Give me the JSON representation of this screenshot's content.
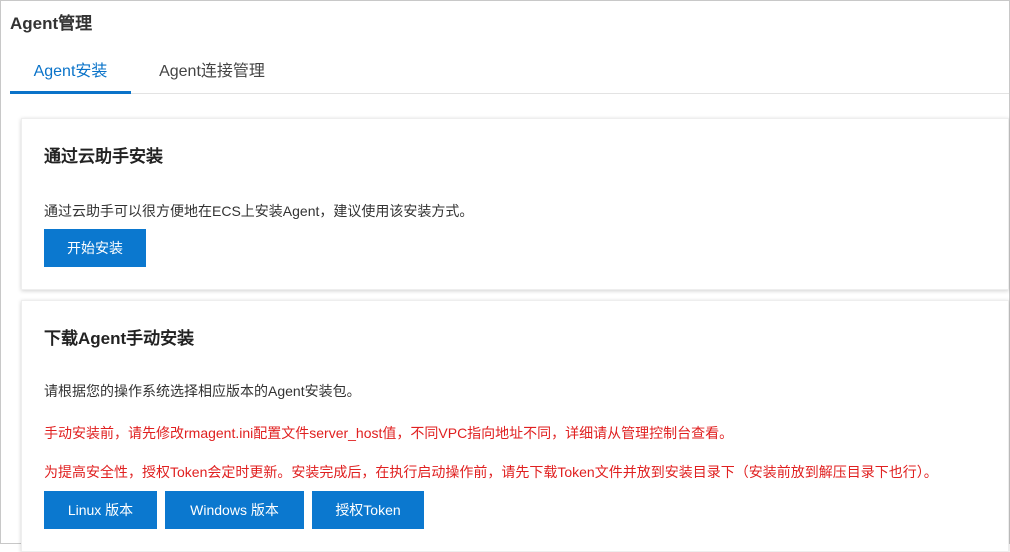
{
  "page": {
    "title": "Agent管理"
  },
  "tabs": [
    {
      "label": "Agent安装",
      "active": true
    },
    {
      "label": "Agent连接管理",
      "active": false
    }
  ],
  "cloud_assistant": {
    "title": "通过云助手安装",
    "description": "通过云助手可以很方便地在ECS上安装Agent，建议使用该安装方式。",
    "start_button": "开始安装"
  },
  "manual": {
    "title": "下载Agent手动安装",
    "description": "请根据您的操作系统选择相应版本的Agent安装包。",
    "warning1": "手动安装前，请先修改rmagent.ini配置文件server_host值，不同VPC指向地址不同，详细请从管理控制台查看。",
    "warning2": "为提高安全性，授权Token会定时更新。安装完成后，在执行启动操作前，请先下载Token文件并放到安装目录下（安装前放到解压目录下也行）。",
    "buttons": {
      "linux": "Linux 版本",
      "windows": "Windows 版本",
      "token": "授权Token"
    }
  },
  "colors": {
    "accent": "#0a73c9",
    "button": "#0b78cf",
    "warning": "#e02020"
  }
}
